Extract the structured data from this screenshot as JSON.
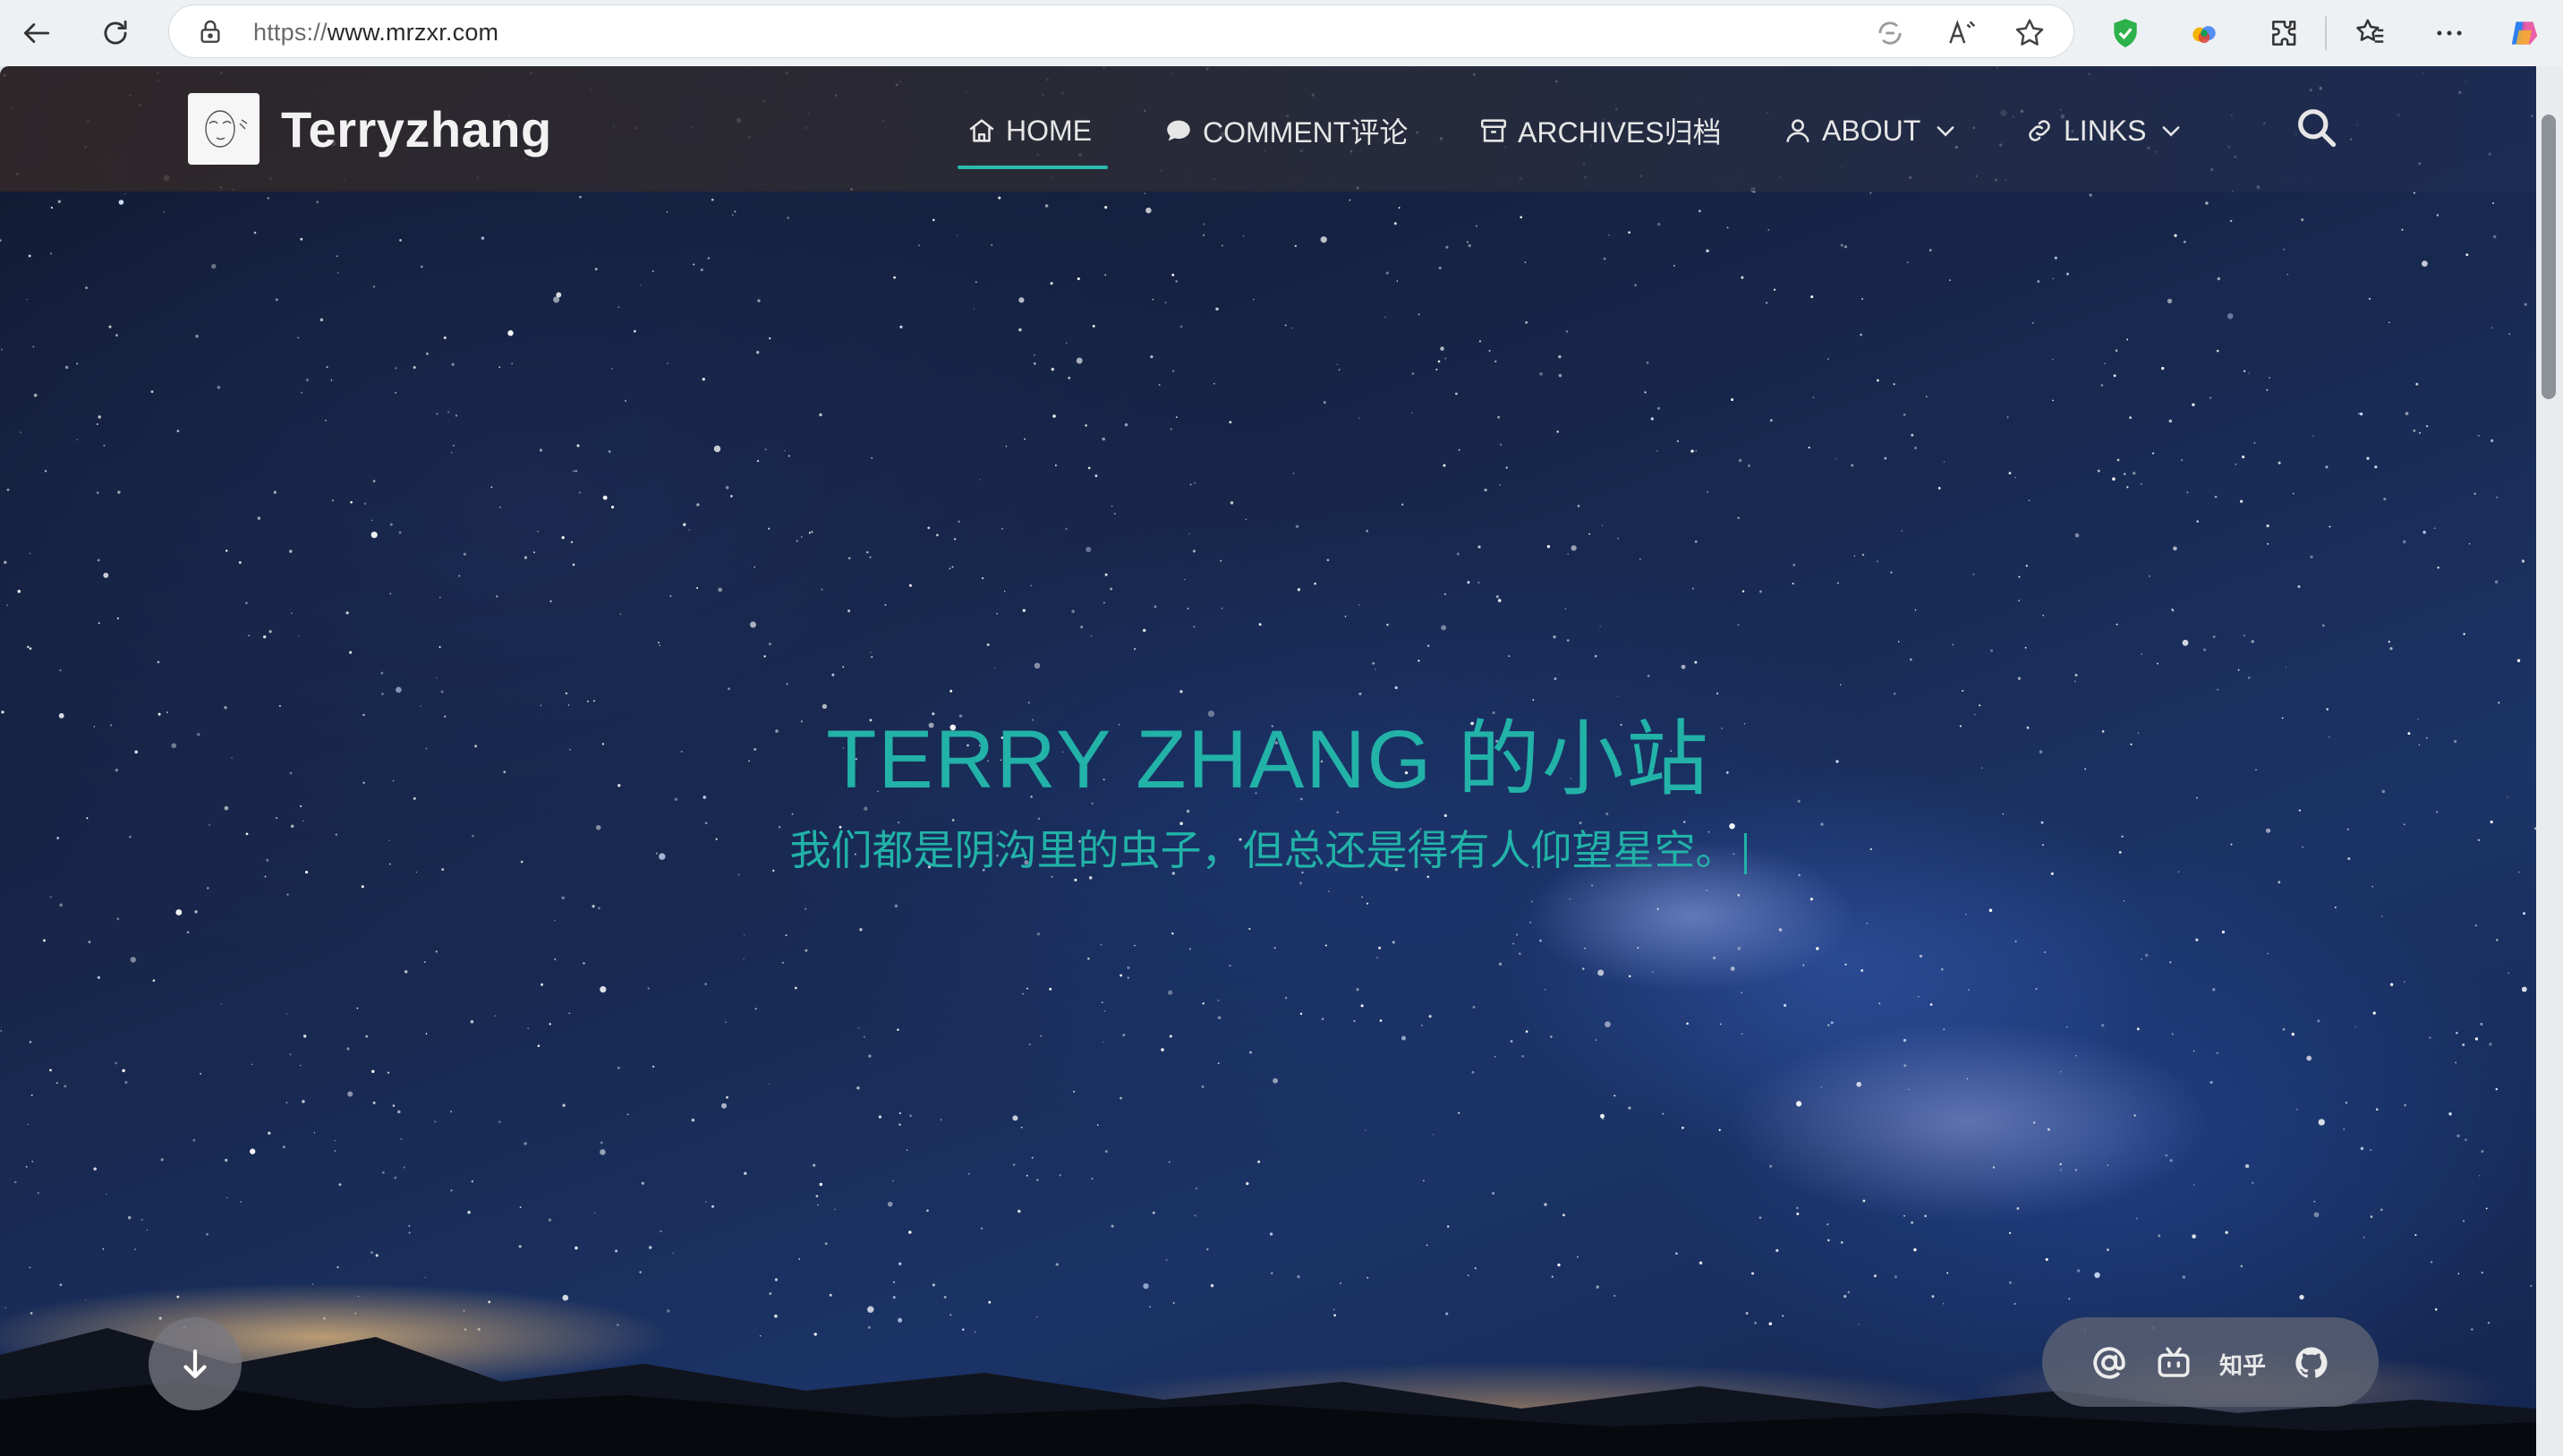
{
  "browser": {
    "url_scheme": "https://",
    "url_host": "www.mrzxr.com",
    "icons": {
      "back": "arrow-left-icon",
      "refresh": "refresh-icon",
      "lock": "lock-icon",
      "read_aloud": "read-aloud-icon",
      "favorite": "star-icon",
      "shield": "shield-icon",
      "extensions": "puzzle-icon",
      "favorites": "favorites-icon",
      "more": "more-icon",
      "copilot": "copilot-icon"
    }
  },
  "site": {
    "title": "Terryzhang",
    "nav": [
      {
        "label": "HOME",
        "icon": "home-icon",
        "active": true
      },
      {
        "label": "COMMENT评论",
        "icon": "comment-icon"
      },
      {
        "label": "ARCHIVES归档",
        "icon": "archive-icon"
      },
      {
        "label": "ABOUT",
        "icon": "user-icon",
        "dropdown": true
      },
      {
        "label": "LINKS",
        "icon": "link-icon",
        "dropdown": true
      }
    ],
    "accent_color": "#22b2a8"
  },
  "hero": {
    "title": "TERRY ZHANG 的小站",
    "subtitle": "我们都是阴沟里的虫子，但总还是得有人仰望星空。"
  },
  "social": {
    "zhihu_label": "知乎",
    "icons": [
      "email-icon",
      "bilibili-icon",
      "zhihu-icon",
      "github-icon"
    ]
  }
}
